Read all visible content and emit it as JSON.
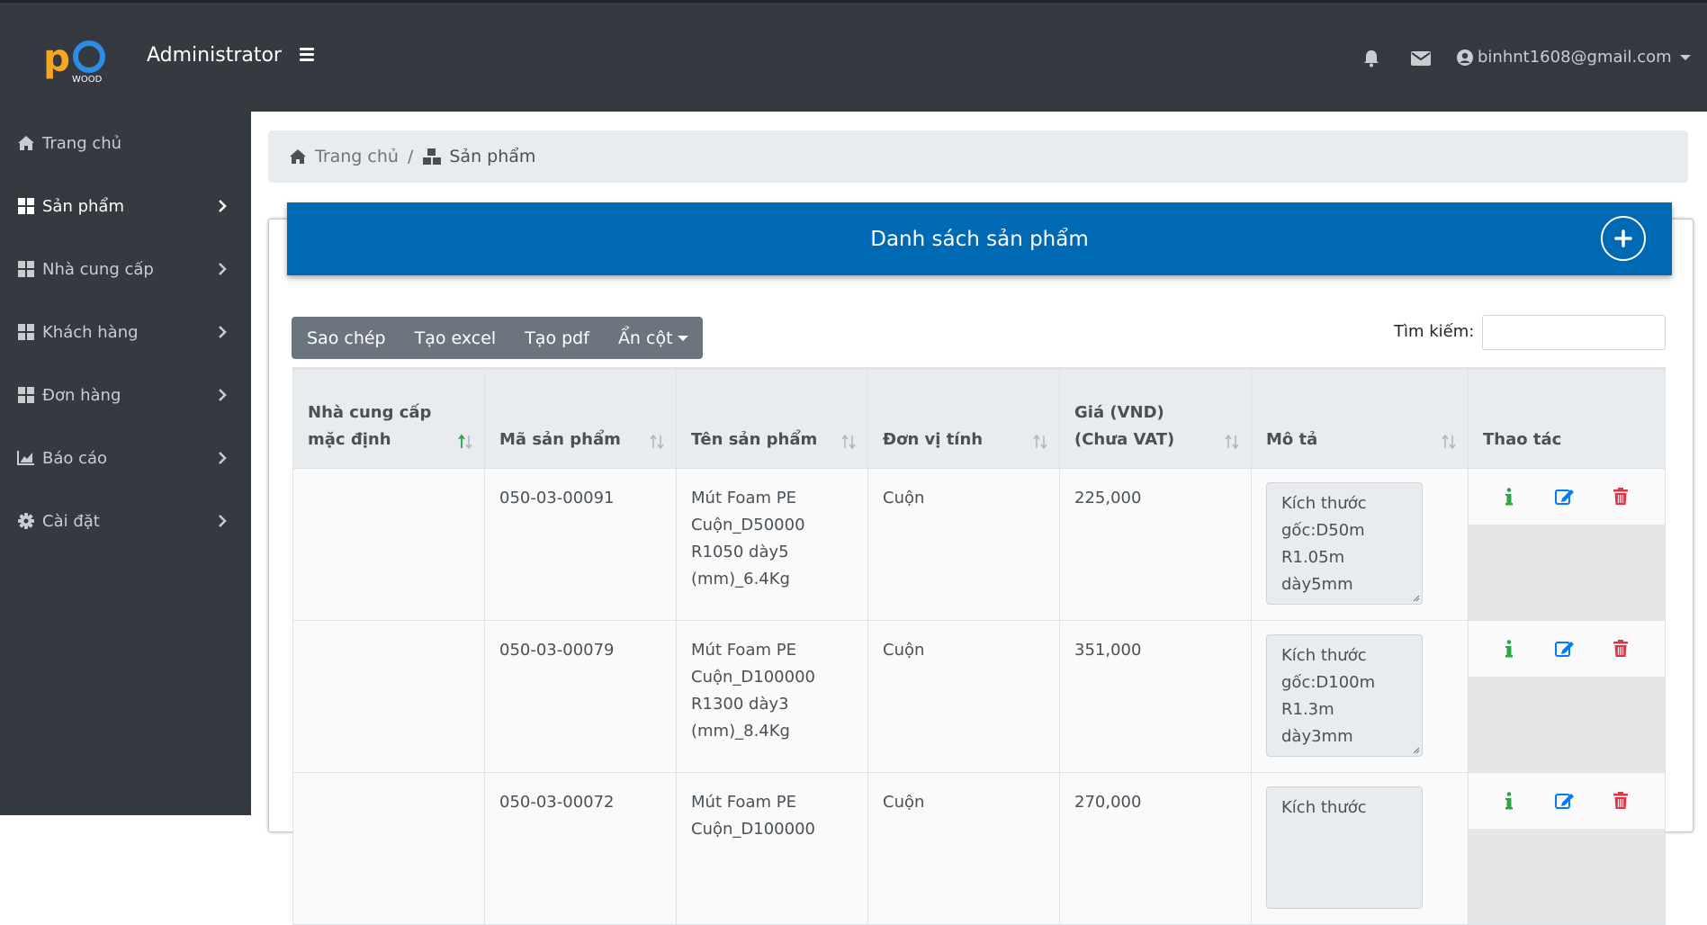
{
  "header": {
    "app_title": "Administrator",
    "logo_text": "WOOD",
    "user_email": "binhnt1608@gmail.com"
  },
  "sidebar": {
    "items": [
      {
        "label": "Trang chủ",
        "icon": "home-icon"
      },
      {
        "label": "Sản phẩm",
        "icon": "grid-icon"
      },
      {
        "label": "Nhà cung cấp",
        "icon": "grid-icon"
      },
      {
        "label": "Khách hàng",
        "icon": "grid-icon"
      },
      {
        "label": "Đơn hàng",
        "icon": "grid-icon"
      },
      {
        "label": "Báo cáo",
        "icon": "chart-icon"
      },
      {
        "label": "Cài đặt",
        "icon": "gear-icon"
      }
    ]
  },
  "breadcrumb": {
    "home": "Trang chủ",
    "separator": "/",
    "current": "Sản phẩm"
  },
  "card": {
    "title": "Danh sách sản phẩm"
  },
  "toolbar": {
    "copy": "Sao chép",
    "excel": "Tạo excel",
    "pdf": "Tạo pdf",
    "columns": "Ẩn cột",
    "search_label": "Tìm kiếm:"
  },
  "table": {
    "headers": {
      "supplier_1": "Nhà cung cấp",
      "supplier_2": "mặc định",
      "code": "Mã sản phẩm",
      "name": "Tên sản phẩm",
      "unit": "Đơn vị tính",
      "price_1": "Giá (VND)",
      "price_2": "(Chưa VAT)",
      "desc": "Mô tả",
      "actions": "Thao tác"
    },
    "rows": [
      {
        "supplier": "",
        "code": "050-03-00091",
        "name": [
          "Mút Foam PE",
          "Cuộn_D50000",
          "R1050 dày5",
          "(mm)_6.4Kg"
        ],
        "unit": "Cuộn",
        "price": "225,000",
        "desc": [
          "Kích thước",
          "gốc:D50m R1.05m",
          "dày5mm"
        ]
      },
      {
        "supplier": "",
        "code": "050-03-00079",
        "name": [
          "Mút Foam PE",
          "Cuộn_D100000",
          "R1300 dày3",
          "(mm)_8.4Kg"
        ],
        "unit": "Cuộn",
        "price": "351,000",
        "desc": [
          "Kích thước",
          "gốc:D100m R1.3m",
          "dày3mm"
        ]
      },
      {
        "supplier": "",
        "code": "050-03-00072",
        "name": [
          "Mút Foam PE",
          "Cuộn_D100000"
        ],
        "unit": "Cuộn",
        "price": "270,000",
        "desc": [
          "Kích thước"
        ]
      }
    ]
  },
  "colors": {
    "topbar": "#343a40",
    "header_blue": "#0069b4",
    "info_green": "#28a745",
    "edit_blue": "#007bff",
    "delete_red": "#dc3545"
  }
}
